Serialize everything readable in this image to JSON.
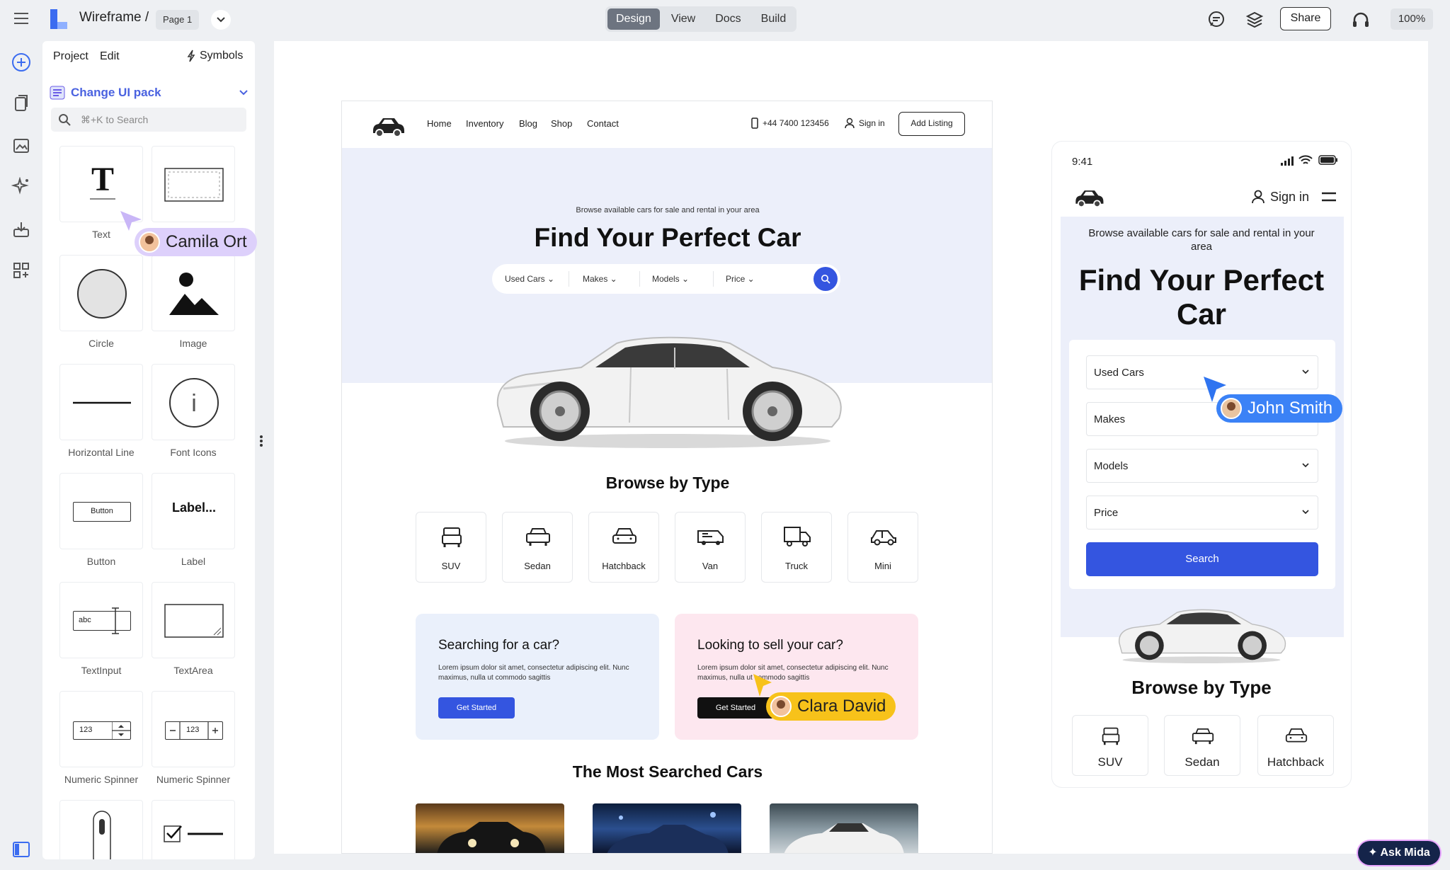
{
  "topbar": {
    "app_title": "Wireframe /",
    "page_label": "Page 1",
    "modes": [
      "Design",
      "View",
      "Docs",
      "Build"
    ],
    "active_mode": "Design",
    "share_label": "Share",
    "zoom": "100%"
  },
  "panel": {
    "tabs": {
      "project": "Project",
      "edit": "Edit",
      "symbols": "Symbols"
    },
    "ui_pack_label": "Change UI pack",
    "search_placeholder": "⌘+K to Search",
    "components": [
      {
        "label": "Text",
        "icon": "text-icon"
      },
      {
        "label": "",
        "icon": "rectangle-icon"
      },
      {
        "label": "Circle",
        "icon": "circle-icon"
      },
      {
        "label": "Image",
        "icon": "image-icon"
      },
      {
        "label": "Horizontal Line",
        "icon": "horizontal-line-icon"
      },
      {
        "label": "Font Icons",
        "icon": "info-icon"
      },
      {
        "label": "Button",
        "icon": "button-icon"
      },
      {
        "label": "Label",
        "icon": "label-icon"
      },
      {
        "label": "TextInput",
        "icon": "text-input-icon"
      },
      {
        "label": "TextArea",
        "icon": "text-area-icon"
      },
      {
        "label": "Numeric Spinner",
        "icon": "numeric-spinner-icon"
      },
      {
        "label": "Numeric Spinner",
        "icon": "numeric-stepper-icon"
      }
    ],
    "component_previews": {
      "button": "Button",
      "label": "Label...",
      "textinput": "abc",
      "spinner": "123"
    }
  },
  "desktop": {
    "nav": [
      "Home",
      "Inventory",
      "Blog",
      "Shop",
      "Contact"
    ],
    "phone": "+44 7400 123456",
    "sign_in": "Sign in",
    "add_listing": "Add Listing",
    "hero_sub": "Browse available cars for sale and rental in your area",
    "hero_title": "Find Your Perfect Car",
    "search_fields": [
      "Used Cars",
      "Makes",
      "Models",
      "Price"
    ],
    "browse_title": "Browse by Type",
    "types": [
      "SUV",
      "Sedan",
      "Hatchback",
      "Van",
      "Truck",
      "Mini"
    ],
    "cards": [
      {
        "title": "Searching for a car?",
        "body": "Lorem ipsum dolor sit amet, consectetur adipiscing elit. Nunc maximus, nulla ut commodo sagittis",
        "button": "Get Started"
      },
      {
        "title": "Looking to sell your car?",
        "body": "Lorem ipsum dolor sit amet, consectetur adipiscing elit. Nunc maximus, nulla ut commodo sagittis",
        "button": "Get Started"
      }
    ],
    "most_searched_title": "The Most Searched Cars"
  },
  "mobile": {
    "time": "9:41",
    "sign_in": "Sign in",
    "hero_sub": "Browse available cars for sale and rental in your area",
    "hero_title": "Find Your Perfect Car",
    "fields": [
      "Used Cars",
      "Makes",
      "Models",
      "Price"
    ],
    "search_button": "Search",
    "browse_title": "Browse by Type",
    "types": [
      "SUV",
      "Sedan",
      "Hatchback"
    ]
  },
  "cursors": [
    {
      "name": "Camila Ort",
      "color": "#d9c8fb"
    },
    {
      "name": "John Smith",
      "color": "#3b82f6"
    },
    {
      "name": "Clara David",
      "color": "#f7c21a"
    }
  ],
  "ask_button": "Ask Mida",
  "colors": {
    "primary": "#3455e0",
    "hero_bg": "#eceffa",
    "card_blue": "#eaf0fb",
    "card_pink": "#fde7ef"
  }
}
